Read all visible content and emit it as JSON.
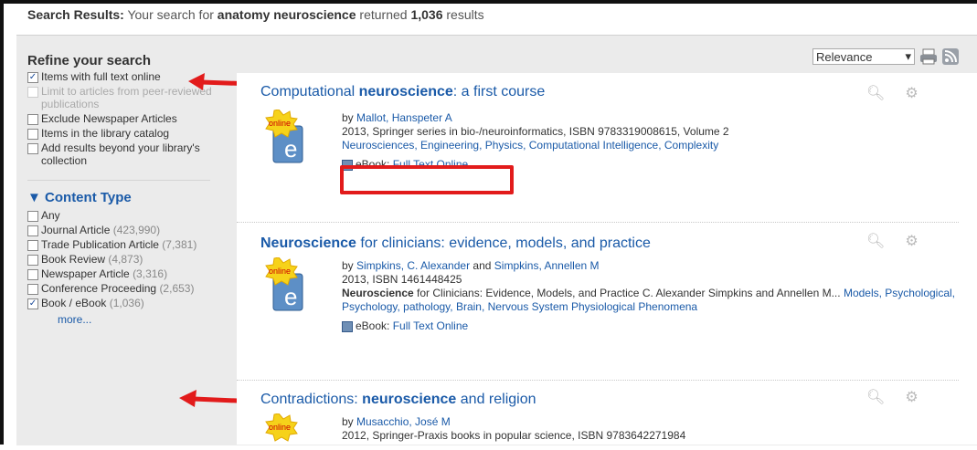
{
  "header": {
    "label": "Search Results:",
    "text_pre": " Your search for ",
    "query": "anatomy neuroscience",
    "text_mid": " returned ",
    "count": "1,036",
    "text_post": " results"
  },
  "sort": {
    "selected": "Relevance"
  },
  "refine": {
    "title": "Refine your search",
    "options": [
      {
        "label": "Items with full text online",
        "checked": true,
        "disabled": false
      },
      {
        "label": "Limit to articles from peer-reviewed publications",
        "checked": false,
        "disabled": true
      },
      {
        "label": "Exclude Newspaper Articles",
        "checked": false,
        "disabled": false
      },
      {
        "label": "Items in the library catalog",
        "checked": false,
        "disabled": false
      },
      {
        "label": "Add results beyond your library's collection",
        "checked": false,
        "disabled": false
      }
    ]
  },
  "content_type": {
    "title": "Content Type",
    "items": [
      {
        "label": "Any",
        "count": "",
        "checked": false
      },
      {
        "label": "Journal Article",
        "count": "(423,990)",
        "checked": false
      },
      {
        "label": "Trade Publication Article",
        "count": "(7,381)",
        "checked": false
      },
      {
        "label": "Book Review",
        "count": "(4,873)",
        "checked": false
      },
      {
        "label": "Newspaper Article",
        "count": "(3,316)",
        "checked": false
      },
      {
        "label": "Conference Proceeding",
        "count": "(2,653)",
        "checked": false
      },
      {
        "label": "Book / eBook",
        "count": "(1,036)",
        "checked": true
      }
    ],
    "more": "more..."
  },
  "badge_text": "online",
  "results": [
    {
      "title_pre": "Computational ",
      "title_bold": "neuroscience",
      "title_post": ": a first course",
      "by": "by ",
      "authors": [
        "Mallot, Hanspeter A"
      ],
      "pub": "2013, Springer series in bio-/neuroinformatics, ISBN 9783319008615, Volume 2",
      "subjects": "Neurosciences, Engineering, Physics, Computational Intelligence, Complexity",
      "ebook_label": "eBook:",
      "ebook_link": "Full Text Online"
    },
    {
      "title_pre": "",
      "title_bold": "Neuroscience",
      "title_post": " for clinicians: evidence, models, and practice",
      "by": "by ",
      "authors": [
        "Simpkins, C. Alexander",
        "Simpkins, Annellen M"
      ],
      "and": " and ",
      "pub": "2013, ISBN 1461448425",
      "snippet_bold": "Neuroscience",
      "snippet": " for Clinicians: Evidence, Models, and Practice C. Alexander Simpkins and Annellen M...",
      "subjects": "Models, Psychological, Psychology, pathology, Brain, Nervous System Physiological Phenomena",
      "ebook_label": "eBook:",
      "ebook_link": "Full Text Online"
    },
    {
      "title_pre": "Contradictions: ",
      "title_bold": "neuroscience",
      "title_post": " and religion",
      "by": "by ",
      "authors": [
        "Musacchio, José M"
      ],
      "pub": "2012, Springer-Praxis books in popular science, ISBN 9783642271984"
    }
  ]
}
